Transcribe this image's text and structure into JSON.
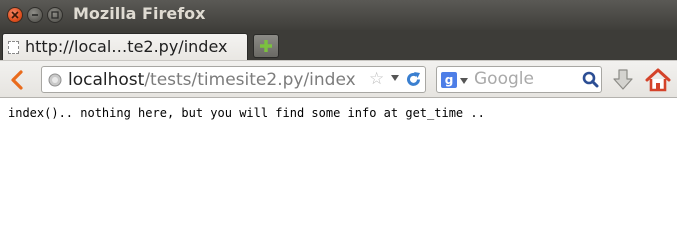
{
  "window": {
    "title": "Mozilla Firefox"
  },
  "tabs": [
    {
      "label": "http://local…te2.py/index"
    }
  ],
  "navbar": {
    "url_host": "localhost",
    "url_path": "/tests/timesite2.py/index",
    "search_placeholder": "Google"
  },
  "page": {
    "body_text": "index().. nothing here, but you will find some info at get_time .."
  },
  "colors": {
    "close_button": "#e0501f",
    "titlebar": "#3f3e3a",
    "new_tab_plus": "#7bc13e",
    "back_arrow": "#e96b1c",
    "reload": "#3a7fd0",
    "home": "#d4432a"
  }
}
